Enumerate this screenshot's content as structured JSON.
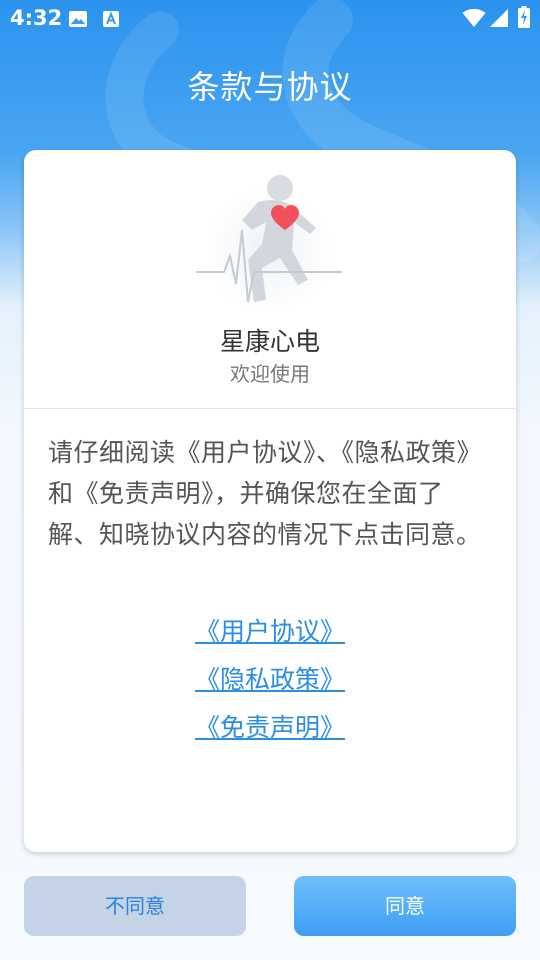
{
  "status_bar": {
    "time": "4:32",
    "left_icons": [
      "image-icon",
      "keyboard-a-icon"
    ],
    "right_icons": [
      "wifi-icon",
      "signal-icon",
      "battery-charging-icon"
    ]
  },
  "page": {
    "title": "条款与协议"
  },
  "card": {
    "app_name": "星康心电",
    "app_subtitle": "欢迎使用",
    "notice": "请仔细阅读《用户协议》、《隐私政策》和《免责声明》，并确保您在全面了解、知晓协议内容的情况下点击同意。",
    "links": [
      "《用户协议》",
      "《隐私政策》",
      "《免责声明》"
    ]
  },
  "buttons": {
    "disagree": "不同意",
    "agree": "同意"
  },
  "colors": {
    "header_blue": "#2b93ee",
    "link_blue": "#2b8de6",
    "agree_button": "#4aa7f5",
    "disagree_button": "#c4d4e6",
    "heart_red": "#f2505a"
  }
}
